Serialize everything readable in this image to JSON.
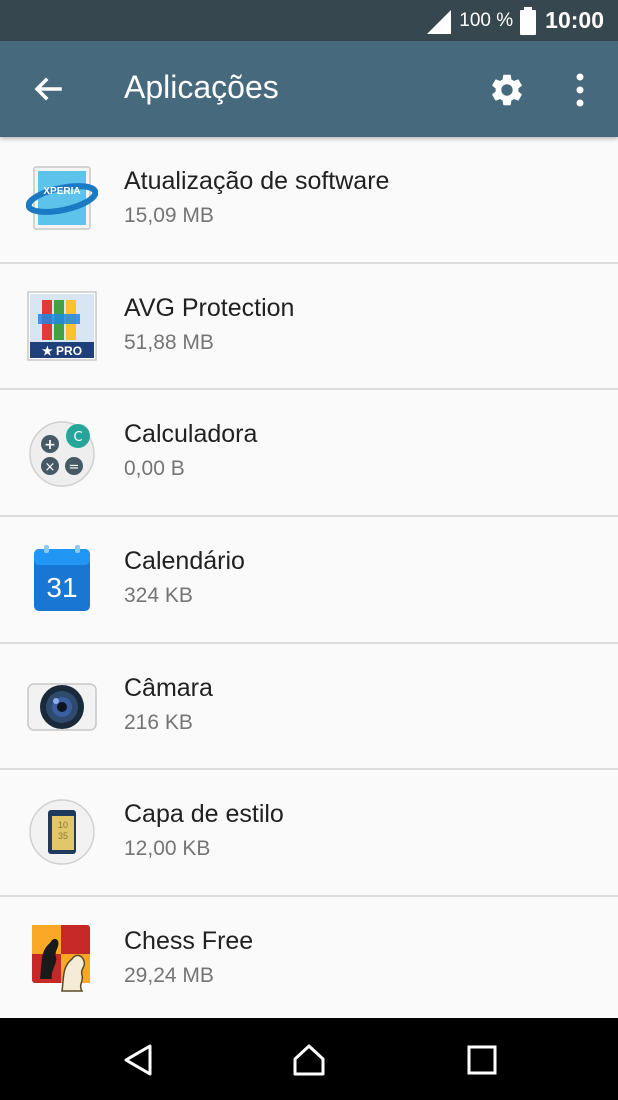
{
  "status_bar": {
    "battery_percent": "100 %",
    "time": "10:00"
  },
  "app_bar": {
    "title": "Aplicações",
    "back_icon": "arrow-left-icon",
    "settings_icon": "gear-icon",
    "menu_icon": "more-vertical-icon"
  },
  "apps": [
    {
      "name": "Atualização de software",
      "size": "15,09 MB",
      "icon": "xperia-update-icon"
    },
    {
      "name": "AVG Protection",
      "size": "51,88 MB",
      "icon": "avg-protection-icon",
      "badge": "★ PRO"
    },
    {
      "name": "Calculadora",
      "size": "0,00 B",
      "icon": "calculator-icon"
    },
    {
      "name": "Calendário",
      "size": "324 KB",
      "icon": "calendar-icon",
      "day": "31"
    },
    {
      "name": "Câmara",
      "size": "216 KB",
      "icon": "camera-icon"
    },
    {
      "name": "Capa de estilo",
      "size": "12,00 KB",
      "icon": "style-cover-icon"
    },
    {
      "name": "Chess Free",
      "size": "29,24 MB",
      "icon": "chess-icon"
    }
  ],
  "nav_bar": {
    "back_icon": "nav-back-icon",
    "home_icon": "nav-home-icon",
    "recents_icon": "nav-recents-icon"
  },
  "colors": {
    "status_bar": "#37474f",
    "app_bar": "#46697d",
    "background": "#fafafa",
    "primary_text": "#212121",
    "secondary_text": "#757575"
  }
}
